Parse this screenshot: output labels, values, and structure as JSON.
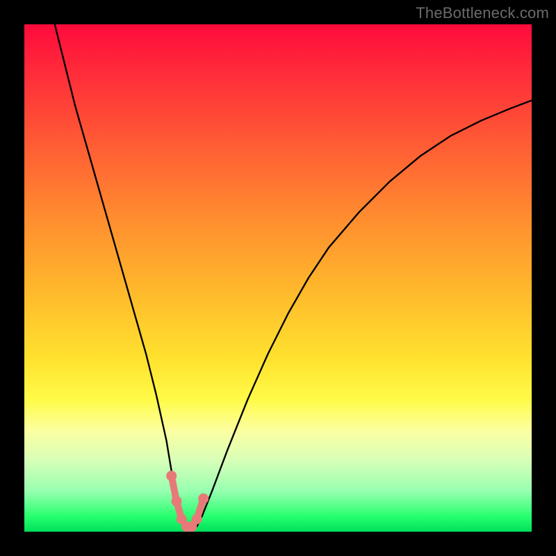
{
  "watermark": "TheBottleneck.com",
  "colors": {
    "frame": "#000000",
    "curve": "#000000",
    "marker_fill": "#e77a78",
    "marker_stroke": "#e77a78",
    "gradient_stops": [
      "#ff0b3c",
      "#ff2d3a",
      "#ff5d34",
      "#ff8c2f",
      "#ffb72c",
      "#ffe22e",
      "#fffb48",
      "#fcffa0",
      "#d7ffb8",
      "#97ffb0",
      "#27ff6f",
      "#00e05a"
    ]
  },
  "chart_data": {
    "type": "line",
    "title": "",
    "xlabel": "",
    "ylabel": "",
    "xlim": [
      0,
      100
    ],
    "ylim": [
      0,
      100
    ],
    "grid": false,
    "legend": false,
    "series": [
      {
        "name": "bottleneck-curve",
        "x": [
          6,
          8,
          10,
          12,
          14,
          16,
          18,
          20,
          22,
          24,
          26,
          28,
          29,
          30,
          31,
          32,
          33,
          34,
          35,
          37,
          40,
          44,
          48,
          52,
          56,
          60,
          66,
          72,
          78,
          84,
          90,
          96,
          100
        ],
        "y": [
          100,
          92,
          84,
          77,
          70,
          63,
          56,
          49,
          42,
          35,
          27,
          18,
          12,
          7,
          3,
          1,
          0.5,
          1,
          3,
          8,
          16,
          26,
          35,
          43,
          50,
          56,
          63,
          69,
          74,
          78,
          81,
          83.5,
          85
        ]
      }
    ],
    "markers": {
      "name": "optimal-region",
      "x": [
        29.0,
        30.0,
        31.0,
        32.0,
        33.0,
        34.0,
        35.3
      ],
      "y": [
        11.0,
        6.0,
        2.5,
        1.0,
        1.0,
        2.5,
        6.5
      ]
    },
    "annotations": []
  }
}
